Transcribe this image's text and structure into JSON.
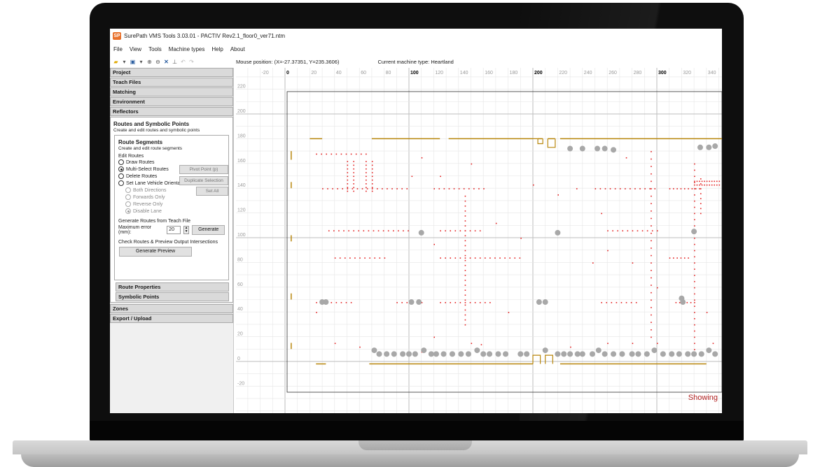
{
  "window": {
    "title": "SurePath VMS Tools 3.03.01 - PACTIV Rev2.1_floor0_ver71.ntm",
    "logo_text": "SP"
  },
  "menu": [
    "File",
    "View",
    "Tools",
    "Machine types",
    "Help",
    "About"
  ],
  "toolbar_icons": [
    "open-folder-icon",
    "save-icon",
    "zoom-in-icon",
    "zoom-out-icon",
    "fit-icon",
    "measure-icon",
    "undo-icon",
    "redo-icon"
  ],
  "sidebar": {
    "panels_top": [
      "Project",
      "Teach Files",
      "Matching",
      "Environment",
      "Reflectors"
    ],
    "routes_section": {
      "title": "Routes and Symbolic Points",
      "desc": "Create and edit routes and symbolic points"
    },
    "segments": {
      "title": "Route Segments",
      "desc": "Create and edit route segments",
      "edit_routes_label": "Edit Routes",
      "modes": [
        {
          "label": "Draw Routes",
          "checked": false
        },
        {
          "label": "Multi-Select Routes",
          "checked": true
        },
        {
          "label": "Delete Routes",
          "checked": false
        },
        {
          "label": "Set Lane Vehicle Orientation",
          "checked": false
        }
      ],
      "orientations": [
        {
          "label": "Both Directions",
          "checked": false
        },
        {
          "label": "Forwards Only",
          "checked": false
        },
        {
          "label": "Reverse Only",
          "checked": false
        },
        {
          "label": "Disable Lane",
          "checked": true
        }
      ],
      "btn_pivot": "Pivot Point (p)",
      "btn_duplicate": "Duplicate Selection",
      "btn_setall": "Set All",
      "generate_label": "Generate Routes from Teach File",
      "max_error_label": "Maximum error (mm):",
      "max_error_value": "20",
      "btn_generate": "Generate",
      "check_label": "Check Routes & Preview Output Intersections",
      "btn_preview": "Generate Preview"
    },
    "sub_panels": [
      "Route Properties",
      "Symbolic Points"
    ],
    "panels_bottom": [
      "Zones",
      "Export / Upload"
    ]
  },
  "status": {
    "mouse_position": "Mouse position: (X=-27.37351, Y=235.3606)",
    "machine_type": "Current machine type: Heartland"
  },
  "canvas": {
    "x_ticks": [
      "-20",
      "0",
      "20",
      "40",
      "60",
      "80",
      "100",
      "120",
      "140",
      "160",
      "180",
      "200",
      "220",
      "240",
      "260",
      "280",
      "300",
      "320",
      "340"
    ],
    "y_ticks": [
      "220",
      "200",
      "180",
      "160",
      "140",
      "120",
      "100",
      "80",
      "60",
      "40",
      "20",
      "0",
      "-20"
    ],
    "bold_x_ticks": [
      "0",
      "100",
      "200",
      "300"
    ],
    "showing_text": "Showing",
    "colors": {
      "route_dots": "#e32020",
      "wall": "#b8860b",
      "reflector": "#a8a8a8",
      "grid": "#e6e6e6",
      "showing": "#b22222"
    }
  }
}
